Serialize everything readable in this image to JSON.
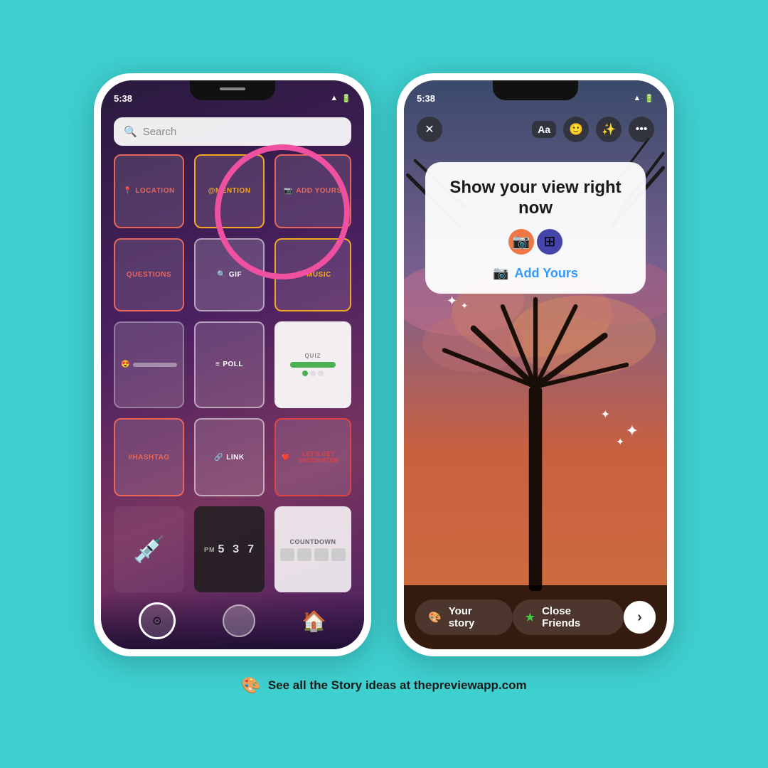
{
  "background": "#3ECFCF",
  "phone1": {
    "time": "5:38",
    "searchPlaceholder": "Search",
    "stickers": [
      {
        "id": "location",
        "label": "LOCATION",
        "icon": "📍"
      },
      {
        "id": "mention",
        "label": "@MENTION",
        "icon": ""
      },
      {
        "id": "addyours",
        "label": "ADD YOURS",
        "icon": "📷"
      },
      {
        "id": "questions",
        "label": "QUESTIONS",
        "icon": ""
      },
      {
        "id": "gif",
        "label": "GIF",
        "icon": "🔍"
      },
      {
        "id": "music",
        "label": "MUSIC",
        "icon": "🎵"
      },
      {
        "id": "emoji",
        "label": "😍",
        "icon": ""
      },
      {
        "id": "poll",
        "label": "POLL",
        "icon": "≡"
      },
      {
        "id": "quiz",
        "label": "QUIZ",
        "icon": ""
      },
      {
        "id": "hashtag",
        "label": "#HASHTAG",
        "icon": ""
      },
      {
        "id": "link",
        "label": "LINK",
        "icon": "🔗"
      },
      {
        "id": "vaccinated",
        "label": "LET'S GET VACCINATED",
        "icon": "❤️"
      },
      {
        "id": "sticker-vacc",
        "label": "",
        "icon": "💉"
      },
      {
        "id": "timer",
        "label": "5  3  7",
        "icon": ""
      },
      {
        "id": "countdown",
        "label": "COUNTDOWN",
        "icon": ""
      }
    ]
  },
  "phone2": {
    "time": "5:38",
    "card": {
      "title": "Show your view right now",
      "addYoursLabel": "Add Yours"
    },
    "bottomBar": {
      "yourStory": "Your story",
      "closeFriends": "Close Friends"
    },
    "topBar": {
      "aaLabel": "Aa"
    }
  },
  "footer": {
    "text": "See all the Story ideas at thepreviewapp.com",
    "icon": "🎨"
  }
}
